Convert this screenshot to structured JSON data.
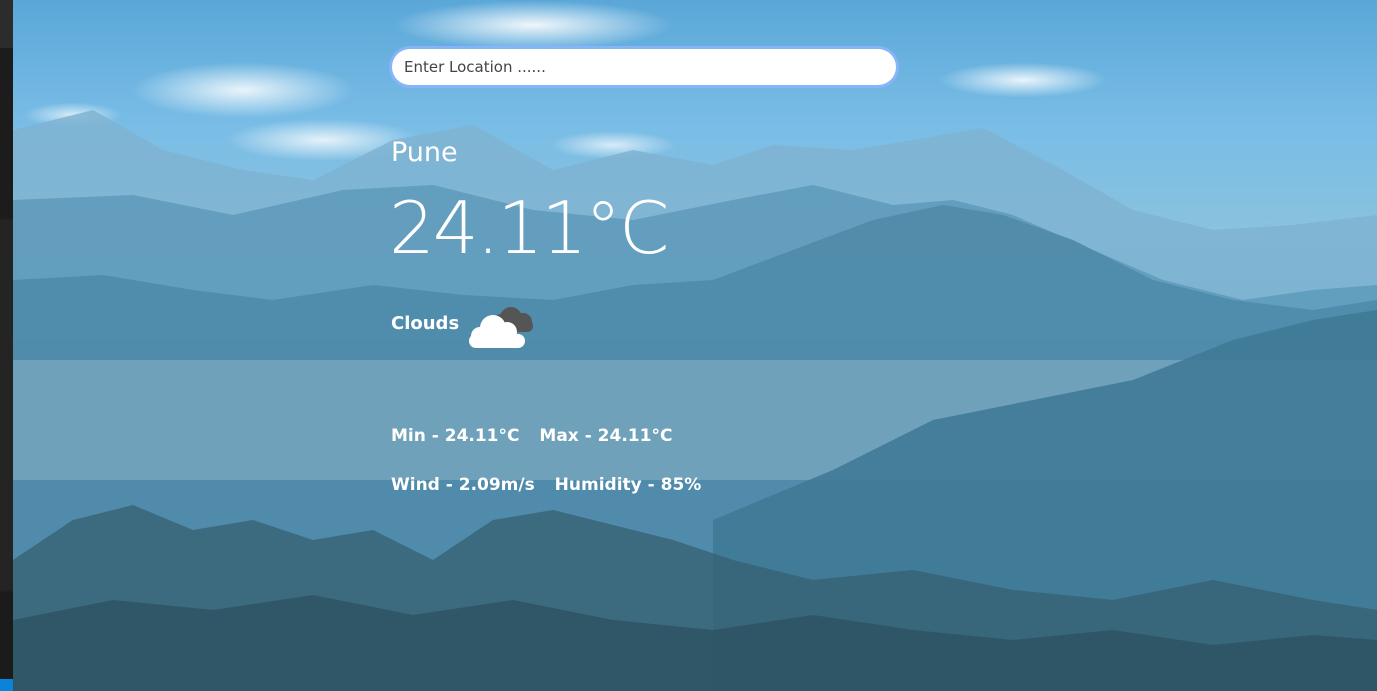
{
  "search": {
    "placeholder": "Enter Location ......"
  },
  "weather": {
    "city": "Pune",
    "temperature": "24.11°C",
    "condition": "Clouds",
    "min": "Min - 24.11°C",
    "max": "Max - 24.11°C",
    "wind": "Wind - 2.09m/s",
    "humidity": "Humidity - 85%",
    "icon": "cloudy-icon"
  },
  "colors": {
    "text": "#ffffff",
    "search_ring": "#8cb4ff",
    "strip": "#1f1f1f",
    "strip_accent": "#0a84d8"
  }
}
